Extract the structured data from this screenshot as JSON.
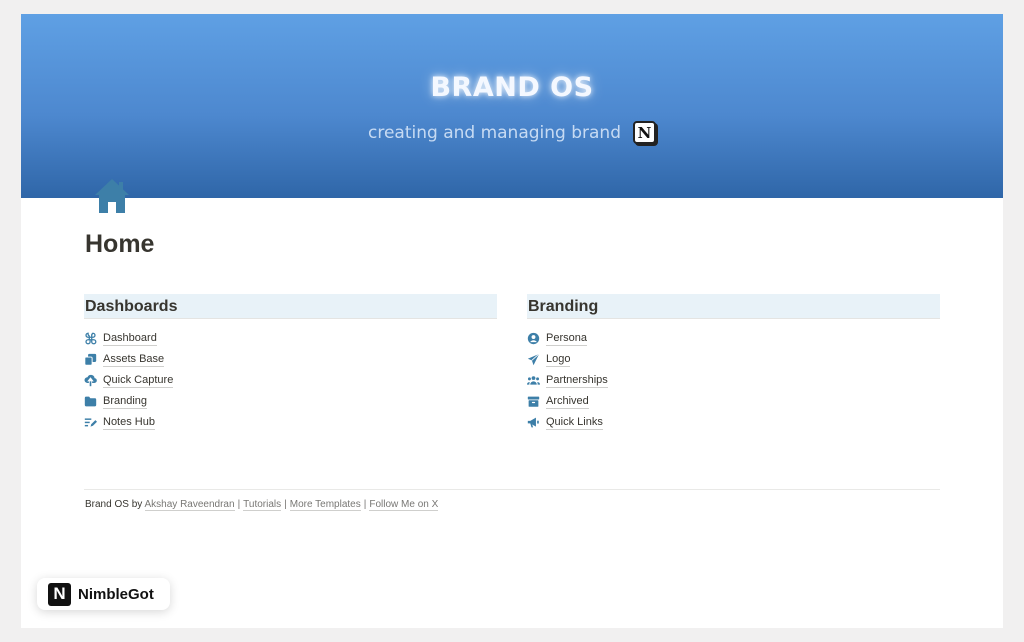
{
  "cover": {
    "title": "BRAND OS",
    "subtitle": "creating and managing brand",
    "notion_icon": "notion-logo-icon",
    "gradient": [
      "#5fa0e4",
      "#2f66a8"
    ]
  },
  "page": {
    "icon": "home-icon",
    "icon_color": "#3d7fa8",
    "title": "Home"
  },
  "columns": [
    {
      "heading": "Dashboards",
      "items": [
        {
          "label": "Dashboard",
          "icon": "command-icon"
        },
        {
          "label": "Assets Base",
          "icon": "copy-icon"
        },
        {
          "label": "Quick Capture",
          "icon": "cloud-upload-icon"
        },
        {
          "label": "Branding",
          "icon": "folder-icon"
        },
        {
          "label": "Notes Hub",
          "icon": "notes-icon"
        }
      ]
    },
    {
      "heading": "Branding",
      "items": [
        {
          "label": "Persona",
          "icon": "user-circle-icon"
        },
        {
          "label": "Logo",
          "icon": "paper-plane-icon"
        },
        {
          "label": "Partnerships",
          "icon": "users-icon"
        },
        {
          "label": "Archived",
          "icon": "archive-icon"
        },
        {
          "label": "Quick Links",
          "icon": "megaphone-icon"
        }
      ]
    }
  ],
  "footer": {
    "prefix": "Brand OS by",
    "author": "Akshay Raveendran",
    "separator": "|",
    "tutorials": "Tutorials",
    "more_templates": "More Templates",
    "follow": "Follow Me on X"
  },
  "badge": {
    "logo_letter": "N",
    "text": "NimbleGot"
  },
  "colors": {
    "icon_blue": "#3d7fa8",
    "heading_bg": "#e8f2f8"
  }
}
